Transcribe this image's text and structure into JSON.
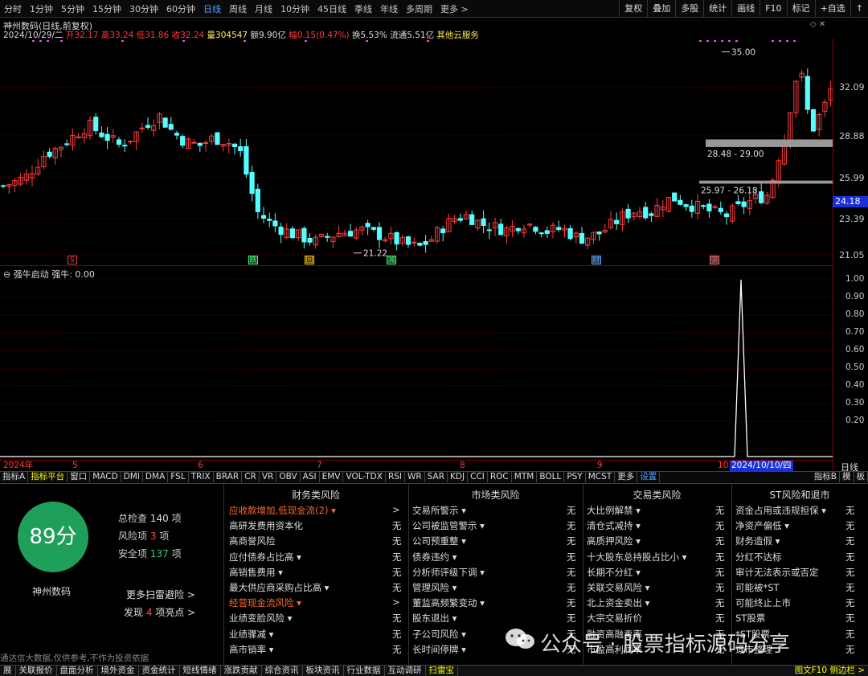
{
  "toolbar": {
    "timeframes": [
      "分时",
      "1分钟",
      "5分钟",
      "15分钟",
      "30分钟",
      "60分钟",
      "日线",
      "周线",
      "月线",
      "10分钟",
      "45日线",
      "季线",
      "年线",
      "多周期",
      "更多 >"
    ],
    "active_timeframe": "日线",
    "right_buttons": [
      "复权",
      "叠加",
      "多股",
      "统计",
      "画线",
      "F10",
      "标记",
      "+自选",
      "↑"
    ]
  },
  "stock": {
    "title": "神州数码(日线,前复权)",
    "name": "神州数码",
    "date": "2024/10/29/二",
    "open_label": "开",
    "open": "32.17",
    "high_label": "高",
    "high": "33.24",
    "low_label": "低",
    "low": "31.86",
    "close_label": "收",
    "close": "32.24",
    "vol_label": "量",
    "vol": "304547",
    "amount_label": "额",
    "amount": "9.90亿",
    "change_label": "幅",
    "change": "0.15(0.47%)",
    "turnover_label": "换",
    "turnover": "5.53%",
    "float_label": "流通",
    "float": "5.51亿",
    "extra": "其他云服务",
    "current_price": "24.18"
  },
  "price_axis": [
    "32.09",
    "28.88",
    "25.99",
    "23.39",
    "21.05"
  ],
  "annotations": {
    "high_label": "35.00",
    "low_label": "21.22",
    "zone1": "28.48 - 29.00",
    "zone2": "25.97 - 26.18"
  },
  "markers": [
    {
      "text": "S",
      "color": "#ff3333"
    },
    {
      "text": "跌",
      "color": "#33ff66"
    },
    {
      "text": "回",
      "color": "#ffcc00"
    },
    {
      "text": "减",
      "color": "#33ff66"
    },
    {
      "text": "财",
      "color": "#4ea3ff"
    },
    {
      "text": "张",
      "color": "#ff6666"
    }
  ],
  "indicator": {
    "name": "强牛启动",
    "value_label": "强牛: 0.00",
    "axis": [
      "1.00",
      "0.90",
      "0.80",
      "0.70",
      "0.60",
      "0.50",
      "0.40",
      "0.30",
      "0.20"
    ],
    "peak_value": 1.0
  },
  "x_axis": {
    "labels": [
      "2024年",
      "5",
      "6",
      "7",
      "8",
      "9",
      "10"
    ],
    "selected_date": "2024/10/10/四",
    "period": "日线"
  },
  "indicator_tabs": [
    "指标A",
    "指标平台",
    "窗口",
    "MACD",
    "DMI",
    "DMA",
    "FSL",
    "TRIX",
    "BRAR",
    "CR",
    "VR",
    "OBV",
    "ASI",
    "EMV",
    "VOL-TDX",
    "RSI",
    "WR",
    "SAR",
    "KDJ",
    "CCI",
    "ROC",
    "MTM",
    "BOLL",
    "PSY",
    "MCST",
    "更多",
    "设置"
  ],
  "indicator_tabs_right": [
    "指标B",
    "模",
    "板"
  ],
  "risk": {
    "score": "89分",
    "name": "神州数码",
    "total_label": "总检查",
    "total": "140",
    "total_unit": "项",
    "risk_label": "风险项",
    "risk_count": "3",
    "risk_unit": "项",
    "safe_label": "安全项",
    "safe_count": "137",
    "safe_unit": "项",
    "more_link": "更多扫雷避险 >",
    "found_label": "发现",
    "found_count": "4",
    "found_unit": "项亮点 >",
    "disclaimer": "通达信大数据,仅供参考,不作为投资依据",
    "columns": [
      {
        "title": "财务类风险",
        "items": [
          {
            "label": "应收款增加,低现金流(2) ▾",
            "value": ">",
            "alert": true
          },
          {
            "label": "高研发费用资本化",
            "value": "无"
          },
          {
            "label": "高商誉风险",
            "value": "无"
          },
          {
            "label": "应付债券占比高 ▾",
            "value": "无"
          },
          {
            "label": "高销售费用 ▾",
            "value": "无"
          },
          {
            "label": "最大供应商采购占比高 ▾",
            "value": "无"
          },
          {
            "label": "经营现金流风险 ▾",
            "value": ">",
            "alert": true
          },
          {
            "label": "业绩变脸风险 ▾",
            "value": "无"
          },
          {
            "label": "业绩骤减 ▾",
            "value": "无"
          },
          {
            "label": "高市销率 ▾",
            "value": "无"
          }
        ]
      },
      {
        "title": "市场类风险",
        "items": [
          {
            "label": "交易所警示 ▾",
            "value": "无"
          },
          {
            "label": "公司被监管警示 ▾",
            "value": "无"
          },
          {
            "label": "公司预重整 ▾",
            "value": "无"
          },
          {
            "label": "债券违约 ▾",
            "value": "无"
          },
          {
            "label": "分析师评级下调 ▾",
            "value": "无"
          },
          {
            "label": "管理风险 ▾",
            "value": "无"
          },
          {
            "label": "董监高频繁变动 ▾",
            "value": "无"
          },
          {
            "label": "股东退出 ▾",
            "value": "无"
          },
          {
            "label": "子公司风险 ▾",
            "value": "无"
          },
          {
            "label": "长时间停牌 ▾",
            "value": "无"
          }
        ]
      },
      {
        "title": "交易类风险",
        "items": [
          {
            "label": "大比例解禁 ▾",
            "value": "无"
          },
          {
            "label": "清仓式减持 ▾",
            "value": "无"
          },
          {
            "label": "高质押风险 ▾",
            "value": "无"
          },
          {
            "label": "十大股东总持股占比小 ▾",
            "value": "无"
          },
          {
            "label": "长期不分红 ▾",
            "value": "无"
          },
          {
            "label": "关联交易风险 ▾",
            "value": "无"
          },
          {
            "label": "北上资金卖出 ▾",
            "value": "无"
          },
          {
            "label": "大宗交易折价",
            "value": "无"
          },
          {
            "label": "融资高融卖率",
            "value": "无"
          },
          {
            "label": "市盈高利润率",
            "value": "无"
          }
        ]
      },
      {
        "title": "ST风险和退市",
        "items": [
          {
            "label": "资金占用或违规担保 ▾",
            "value": "无"
          },
          {
            "label": "净资产偏低 ▾",
            "value": "无"
          },
          {
            "label": "财务造假 ▾",
            "value": "无"
          },
          {
            "label": "分红不达标",
            "value": "无"
          },
          {
            "label": "审计无法表示或否定",
            "value": "无"
          },
          {
            "label": "可能被*ST",
            "value": "无"
          },
          {
            "label": "可能终止上市",
            "value": "无"
          },
          {
            "label": "ST股票",
            "value": "无"
          },
          {
            "label": "*ST股票",
            "value": "无"
          },
          {
            "label": "退市整理",
            "value": "无"
          }
        ]
      }
    ]
  },
  "watermark": "公众号 · 股票指标源码分享",
  "statusbar": [
    "展",
    "关联报价",
    "盘面分析",
    "境外资金",
    "资金统计",
    "短线情绪",
    "涨跌贡献",
    "综合资讯",
    "板块资讯",
    "行业数据",
    "互动调研",
    "扫雷宝"
  ],
  "statusbar_right": "图文F10 侧边栏 >",
  "colors": {
    "up": "#ff3c3c",
    "down": "#54ffff",
    "accent": "#1fa05a",
    "alert": "#ff6a2a",
    "magenta": "#ff44ff"
  }
}
